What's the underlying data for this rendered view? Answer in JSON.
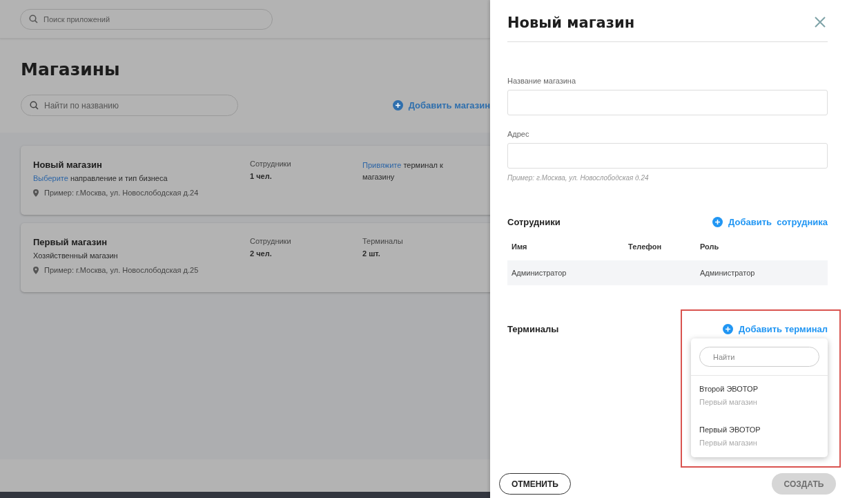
{
  "top_search": {
    "placeholder": "Поиск приложений"
  },
  "page_title": "Магазины",
  "store_search": {
    "placeholder": "Найти по названию"
  },
  "add_store": "Добавить магазин",
  "stores": [
    {
      "kind": "new",
      "name": "Новый магазин",
      "business_link": "Выберите",
      "business_text": "направление и тип бизнеса",
      "address": "Пример: г.Москва, ул. Новослободская д.24",
      "employees_label": "Сотрудники",
      "employees": "1 чел.",
      "terminal_link": "Привяжите",
      "terminal_text": "терминал к магазину"
    },
    {
      "kind": "set",
      "name": "Первый магазин",
      "business": "Хозяйственный магазин",
      "address": "Пример: г.Москва, ул. Новослободская д.25",
      "employees_label": "Сотрудники",
      "employees": "2 чел.",
      "terminals_label": "Терминалы",
      "terminals": "2 шт."
    }
  ],
  "dialog": {
    "title": "Новый магазин",
    "fields": [
      {
        "label": "Название магазина"
      },
      {
        "label": "Адрес",
        "hint": "Пример: г.Москва, ул. Новослободская д.24"
      }
    ],
    "employees": {
      "title": "Сотрудники",
      "add": "Добавить  сотрудника",
      "columns": [
        "Имя",
        "Телефон",
        "Роль"
      ],
      "rows": [
        [
          "Администратор",
          "",
          "Администратор"
        ]
      ]
    },
    "terminals": {
      "title": "Терминалы",
      "add": "Добавить терминал",
      "dropdown": {
        "search_placeholder": "Найти",
        "items": [
          {
            "name": "Второй ЭВОТОР",
            "store": "Первый магазин"
          },
          {
            "name": "Первый ЭВОТОР",
            "store": "Первый магазин"
          }
        ]
      }
    },
    "cancel": "ОТМЕНИТЬ",
    "create": {
      "label": "СОЗДАТЬ",
      "disabled": true
    }
  }
}
